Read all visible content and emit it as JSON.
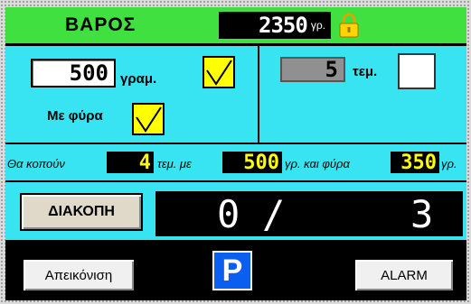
{
  "header": {
    "title": "ΒΑΡΟΣ",
    "weight_value": "2350",
    "weight_unit": "γρ.",
    "lock_icon": "padlock-icon"
  },
  "portion": {
    "grams_value": "500",
    "grams_label": "γραμ.",
    "grams_checked": true,
    "waste_label": "Με φύρα",
    "waste_checked": true,
    "pieces_value": "5",
    "pieces_label": "τεμ.",
    "pieces_checked": false
  },
  "summary": {
    "prefix": "Θα κοπούν",
    "pieces": "4",
    "pieces_text": "τεμ. με",
    "grams": "500",
    "grams_text": "γρ. και φύρα",
    "waste": "350",
    "waste_unit": "γρ."
  },
  "progress": {
    "stop_button": "ΔΙΑΚΟΠΗ",
    "current": "0",
    "separator": "/",
    "total": "3"
  },
  "footer": {
    "display_button": "Απεικόνιση",
    "parking_label": "P",
    "alarm_button": "ALARM"
  },
  "colors": {
    "header_bg": "#3fe03f",
    "panel_bg": "#38e3f2",
    "checkbox_yellow": "#ffff00",
    "parking_blue": "#0a5ef0"
  }
}
